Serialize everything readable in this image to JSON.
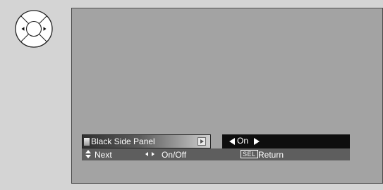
{
  "remote": {
    "icon": "directional-pad-left-right-icon"
  },
  "menu": {
    "item_label": "Black Side Panel",
    "value": "On",
    "value_arrows": {
      "left": "triangle-left-icon",
      "right": "triangle-right-icon"
    }
  },
  "help": {
    "next_label": "Next",
    "onoff_label": "On/Off",
    "sel_key": "SEL",
    "return_label": "Return"
  },
  "colors": {
    "page_background": "#d4d4d4",
    "screen_background": "#a3a3a3",
    "value_box": "#0e0e0e",
    "help_bar": "#5e5e5e",
    "text": "#ffffff"
  }
}
